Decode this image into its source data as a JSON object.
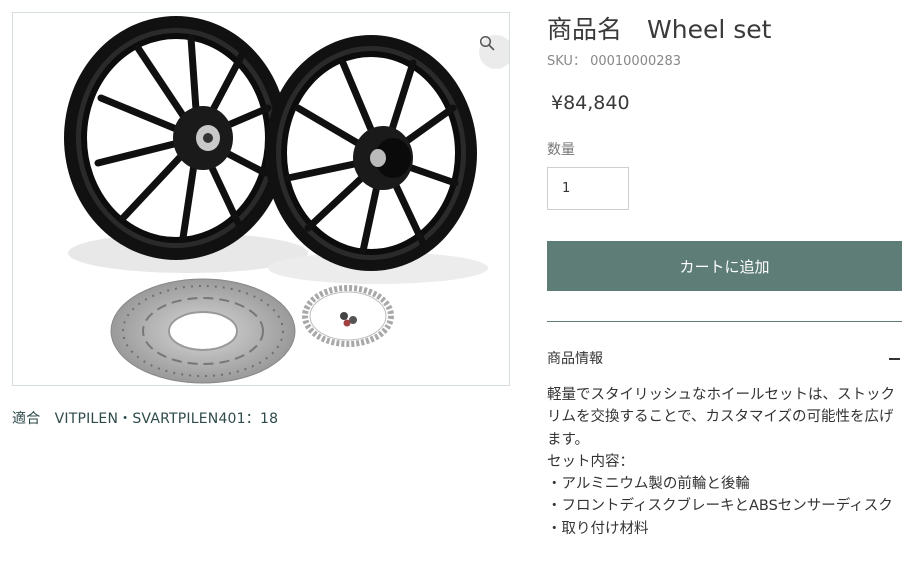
{
  "product": {
    "title": "商品名　Wheel set",
    "sku": "SKU： 00010000283",
    "price": "¥84,840",
    "fit": "適合　VITPILEN・SVARTPILEN401：18",
    "image_alt": "Wheel set"
  },
  "quantity": {
    "label": "数量",
    "value": "1"
  },
  "cart": {
    "button_label": "カートに追加"
  },
  "info": {
    "title": "商品情報",
    "lines": [
      "軽量でスタイリッシュなホイールセットは、ストックリムを交換することで、カスタマイズの可能性を広げます。",
      "セット内容：",
      "・アルミニウム製の前輪と後輪",
      "・フロントディスクブレーキとABSセンサーディスク",
      "・取り付け材料"
    ]
  },
  "icons": {
    "zoom": "magnifier-icon",
    "collapse": "minus-icon"
  },
  "colors": {
    "accent": "#5e7d77",
    "frame_border": "#d6dedc"
  }
}
